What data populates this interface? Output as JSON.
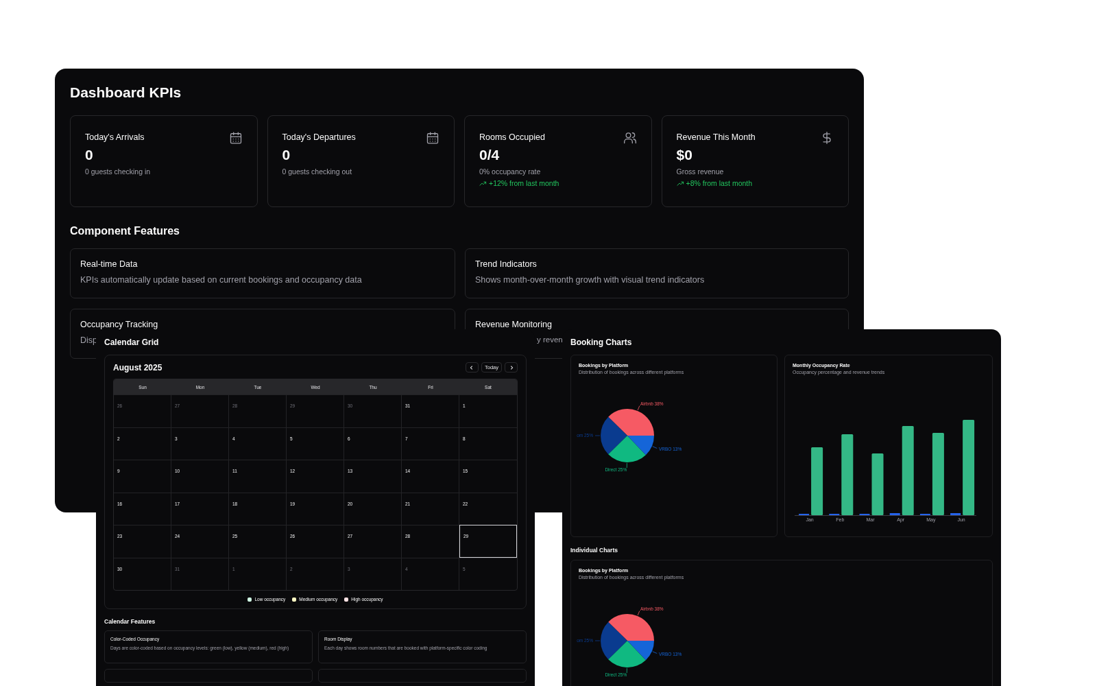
{
  "kpi_panel": {
    "title": "Dashboard KPIs",
    "kpis": [
      {
        "title": "Today's Arrivals",
        "value": "0",
        "subtitle": "0 guests checking in"
      },
      {
        "title": "Today's Departures",
        "value": "0",
        "subtitle": "0 guests checking out"
      },
      {
        "title": "Rooms Occupied",
        "value": "0/4",
        "subtitle": "0% occupancy rate",
        "trend": "+12% from last month"
      },
      {
        "title": "Revenue This Month",
        "value": "$0",
        "subtitle": "Gross revenue",
        "trend": "+8% from last month"
      }
    ],
    "features_title": "Component Features",
    "features": [
      {
        "title": "Real-time Data",
        "description": "KPIs automatically update based on current bookings and occupancy data"
      },
      {
        "title": "Trend Indicators",
        "description": "Shows month-over-month growth with visual trend indicators"
      },
      {
        "title": "Occupancy Tracking",
        "description": "Disp"
      },
      {
        "title": "Revenue Monitoring",
        "description": "y reven"
      }
    ]
  },
  "calendar_panel": {
    "title": "Calendar Grid",
    "month": "August 2025",
    "today_button": "Today",
    "weekdays": [
      "Sun",
      "Mon",
      "Tue",
      "Wed",
      "Thu",
      "Fri",
      "Sat"
    ],
    "weeks": [
      [
        {
          "day": "26",
          "outside": true,
          "today": false
        },
        {
          "day": "27",
          "outside": true,
          "today": false
        },
        {
          "day": "28",
          "outside": true,
          "today": false
        },
        {
          "day": "29",
          "outside": true,
          "today": false
        },
        {
          "day": "30",
          "outside": true,
          "today": false
        },
        {
          "day": "31",
          "outside": false,
          "today": false
        },
        {
          "day": "1",
          "outside": false,
          "today": false
        }
      ],
      [
        {
          "day": "2",
          "outside": false,
          "today": false
        },
        {
          "day": "3",
          "outside": false,
          "today": false
        },
        {
          "day": "4",
          "outside": false,
          "today": false
        },
        {
          "day": "5",
          "outside": false,
          "today": false
        },
        {
          "day": "6",
          "outside": false,
          "today": false
        },
        {
          "day": "7",
          "outside": false,
          "today": false
        },
        {
          "day": "8",
          "outside": false,
          "today": false
        }
      ],
      [
        {
          "day": "9",
          "outside": false,
          "today": false
        },
        {
          "day": "10",
          "outside": false,
          "today": false
        },
        {
          "day": "11",
          "outside": false,
          "today": false
        },
        {
          "day": "12",
          "outside": false,
          "today": false
        },
        {
          "day": "13",
          "outside": false,
          "today": false
        },
        {
          "day": "14",
          "outside": false,
          "today": false
        },
        {
          "day": "15",
          "outside": false,
          "today": false
        }
      ],
      [
        {
          "day": "16",
          "outside": false,
          "today": false
        },
        {
          "day": "17",
          "outside": false,
          "today": false
        },
        {
          "day": "18",
          "outside": false,
          "today": false
        },
        {
          "day": "19",
          "outside": false,
          "today": false
        },
        {
          "day": "20",
          "outside": false,
          "today": false
        },
        {
          "day": "21",
          "outside": false,
          "today": false
        },
        {
          "day": "22",
          "outside": false,
          "today": false
        }
      ],
      [
        {
          "day": "23",
          "outside": false,
          "today": false
        },
        {
          "day": "24",
          "outside": false,
          "today": false
        },
        {
          "day": "25",
          "outside": false,
          "today": false
        },
        {
          "day": "26",
          "outside": false,
          "today": false
        },
        {
          "day": "27",
          "outside": false,
          "today": false
        },
        {
          "day": "28",
          "outside": false,
          "today": false
        },
        {
          "day": "29",
          "outside": false,
          "today": true
        }
      ],
      [
        {
          "day": "30",
          "outside": false,
          "today": false
        },
        {
          "day": "31",
          "outside": true,
          "today": false
        },
        {
          "day": "1",
          "outside": true,
          "today": false
        },
        {
          "day": "2",
          "outside": true,
          "today": false
        },
        {
          "day": "3",
          "outside": true,
          "today": false
        },
        {
          "day": "4",
          "outside": true,
          "today": false
        },
        {
          "day": "5",
          "outside": true,
          "today": false
        }
      ]
    ],
    "legend": [
      {
        "label": "Low occupancy",
        "color": "#d1fae5"
      },
      {
        "label": "Medium occupancy",
        "color": "#fef9c3"
      },
      {
        "label": "High occupancy",
        "color": "#fde2e4"
      }
    ],
    "features_title": "Calendar Features",
    "features": [
      {
        "title": "Color-Coded Occupancy",
        "description": "Days are color-coded based on occupancy levels: green (low), yellow (medium), red (high)"
      },
      {
        "title": "Room Display",
        "description": "Each day shows room numbers that are booked with platform-specific color coding"
      }
    ]
  },
  "charts_panel": {
    "title": "Booking Charts",
    "platform_chart": {
      "title": "Bookings by Platform",
      "subtitle": "Distribution of bookings across different platforms",
      "slices": [
        {
          "label": "Airbnb 38%",
          "color": "#f65a64"
        },
        {
          "label": "om 25%",
          "color": "#0a3b8f"
        },
        {
          "label": "Direct 25%",
          "color": "#10b981"
        },
        {
          "label": "VRBO 13%",
          "color": "#1565d8"
        }
      ],
      "chart_data": {
        "type": "pie",
        "values": [
          38,
          25,
          25,
          13
        ]
      }
    },
    "occupancy_chart": {
      "title": "Monthly Occupancy Rate",
      "subtitle": "Occupancy percentage and revenue trends",
      "months": [
        "Jan",
        "Feb",
        "Mar",
        "Apr",
        "May",
        "Jun"
      ]
    },
    "individual_title": "Individual Charts",
    "individual_chart": {
      "title": "Bookings by Platform",
      "subtitle": "Distribution of bookings across different platforms",
      "slices": [
        {
          "label": "Airbnb 38%",
          "color": "#f65a64"
        },
        {
          "label": "om 25%",
          "color": "#0a3b8f"
        },
        {
          "label": "Direct 25%",
          "color": "#10b981"
        },
        {
          "label": "VRBO 13%",
          "color": "#1565d8"
        }
      ],
      "chart_data": {
        "type": "pie",
        "values": [
          38,
          25,
          25,
          13
        ]
      }
    }
  }
}
